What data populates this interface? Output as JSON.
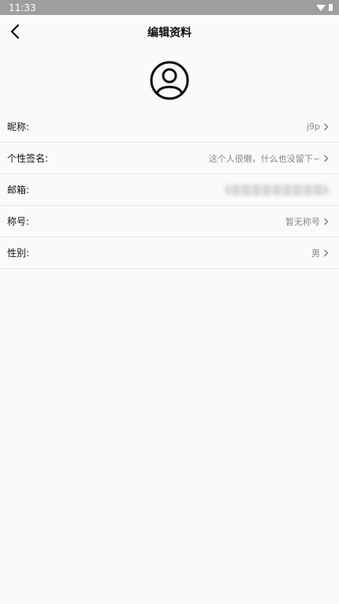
{
  "status_bar": {
    "time": "11:33",
    "icons": [
      "wifi-icon",
      "battery-icon"
    ]
  },
  "header": {
    "title": "编辑资料",
    "back_icon": "chevron-left-icon"
  },
  "avatar": {
    "icon": "user-circle-icon"
  },
  "profile_fields": [
    {
      "label": "昵称:",
      "value": "j9p",
      "has_arrow": true
    },
    {
      "label": "个性签名:",
      "value": "这个人很懒，什么也没留下~",
      "has_arrow": true
    },
    {
      "label": "邮箱:",
      "value": "",
      "blurred": true,
      "has_arrow": false
    },
    {
      "label": "称号:",
      "value": "暂无称号",
      "has_arrow": true
    },
    {
      "label": "性别:",
      "value": "男",
      "has_arrow": true
    }
  ],
  "colors": {
    "background": "#fafafa",
    "status_bar": "#9e9e9e",
    "divider": "#e6e6e6",
    "value_text": "#888888"
  }
}
